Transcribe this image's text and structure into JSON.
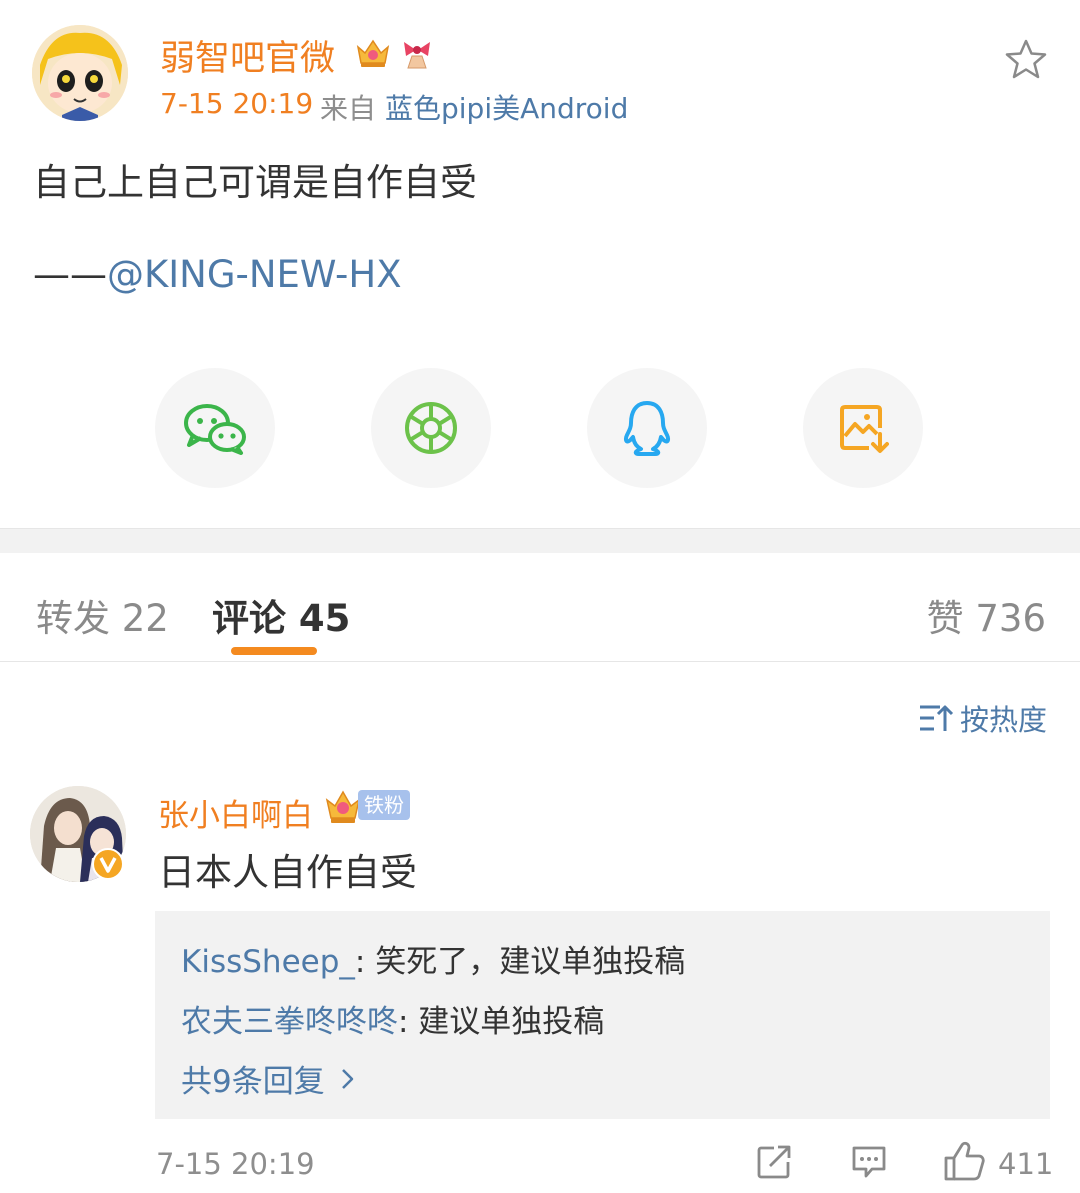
{
  "post": {
    "author_name": "弱智吧官微",
    "time": "7-15 20:19",
    "source_prefix": "来自",
    "source_name": "蓝色pipi美Android",
    "text": "自己上自己可谓是自作自受",
    "mention_dash": "——",
    "mention": "@KING-NEW-HX"
  },
  "share": {
    "items": [
      {
        "icon": "wechat-icon",
        "color": "#3bb54a"
      },
      {
        "icon": "moments-icon",
        "color": "#6cc24a"
      },
      {
        "icon": "qq-icon",
        "color": "#27a8f0"
      },
      {
        "icon": "save-image-icon",
        "color": "#f5a623"
      }
    ]
  },
  "tabs": {
    "repost": "转发 22",
    "comment": "评论 45",
    "like": "赞 736"
  },
  "sort": {
    "label": "按热度"
  },
  "comment": {
    "author": "张小白啊白",
    "fan_badge": "铁粉",
    "text": "日本人自作自受",
    "replies": [
      {
        "name": "KissSheep_",
        "text": ": 笑死了，建议单独投稿"
      },
      {
        "name": "农夫三拳咚咚咚",
        "text": ": 建议单独投稿"
      }
    ],
    "more_replies": "共9条回复",
    "time": "7-15 20:19",
    "like_count": "411"
  },
  "colors": {
    "accent_orange": "#f07f21",
    "link_blue": "#4e7aa8",
    "tab_indicator": "#f48a1f"
  }
}
